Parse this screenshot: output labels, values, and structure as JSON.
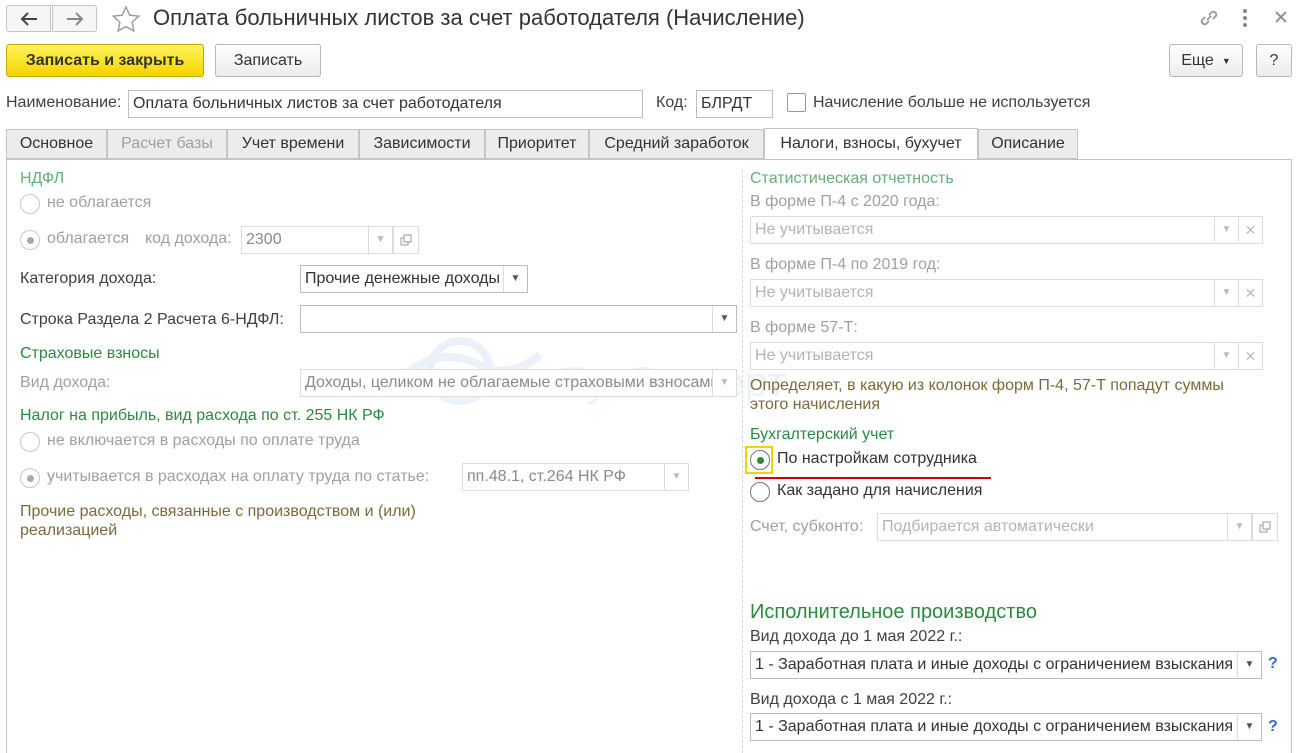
{
  "window": {
    "title": "Оплата больничных листов за счет работодателя (Начисление)"
  },
  "toolbar": {
    "save_close_label": "Записать и закрыть",
    "save_label": "Записать",
    "more_label": "Еще",
    "help_label": "?"
  },
  "header": {
    "name_label": "Наименование:",
    "name_value": "Оплата больничных листов за счет работодателя",
    "code_label": "Код:",
    "code_value": "БЛРДТ",
    "unused_label": "Начисление больше не используется"
  },
  "tabs": [
    {
      "label": "Основное"
    },
    {
      "label": "Расчет базы"
    },
    {
      "label": "Учет времени"
    },
    {
      "label": "Зависимости"
    },
    {
      "label": "Приоритет"
    },
    {
      "label": "Средний заработок"
    },
    {
      "label": "Налоги, взносы, бухучет"
    },
    {
      "label": "Описание"
    }
  ],
  "left": {
    "ndfl_title": "НДФЛ",
    "ndfl_not_taxed": "не облагается",
    "ndfl_taxed": "облагается",
    "income_code_label": "код дохода:",
    "income_code_value": "2300",
    "income_category_label": "Категория дохода:",
    "income_category_value": "Прочие денежные доходы",
    "row6_label": "Строка Раздела 2 Расчета 6-НДФЛ:",
    "row6_value": "",
    "insurance_title": "Страховые взносы",
    "income_kind_label": "Вид дохода:",
    "income_kind_value": "Доходы, целиком не облагаемые страховыми взносами",
    "profit_tax_title": "Налог на прибыль, вид расхода по ст. 255 НК РФ",
    "not_included_label": "не включается в расходы по оплате труда",
    "included_label": "учитывается в расходах на оплату труда по статье:",
    "article_value": "пп.48.1, ст.264 НК РФ",
    "other_expenses_line1": "Прочие расходы, связанные с производством и (или)",
    "other_expenses_line2": "реализацией"
  },
  "right": {
    "stat_title": "Статистическая отчетность",
    "p4_2020_label": "В форме П-4 с 2020 года:",
    "p4_2020_value": "Не учитывается",
    "p4_2019_label": "В форме П-4 по 2019 год:",
    "p4_2019_value": "Не учитывается",
    "f57_label": "В форме 57-Т:",
    "f57_value": "Не учитывается",
    "stat_note_line1": "Определяет, в какую из колонок форм П-4, 57-Т попадут суммы",
    "stat_note_line2": "этого начисления",
    "acc_title": "Бухгалтерский учет",
    "acc_by_employee": "По настройкам сотрудника",
    "acc_as_set": "Как задано для начисления",
    "account_label": "Счет, субконто:",
    "account_placeholder": "Подбирается автоматически",
    "exec_title": "Исполнительное производство",
    "exec_before_label": "Вид дохода до 1 мая 2022 г.:",
    "exec_before_value": "1 - Заработная плата и иные доходы с ограничением взыскания",
    "exec_after_label": "Вид дохода с 1 мая 2022 г.:",
    "exec_after_value": "1 - Заработная плата и иные доходы с ограничением взыскания",
    "help_mark": "?"
  },
  "watermark": {
    "text": "БухЭксперт"
  },
  "colors": {
    "primary_button": "#f5d800",
    "section_green": "#2b8a3e",
    "highlight_red": "#d00000",
    "highlight_yellow": "#f2d200"
  }
}
